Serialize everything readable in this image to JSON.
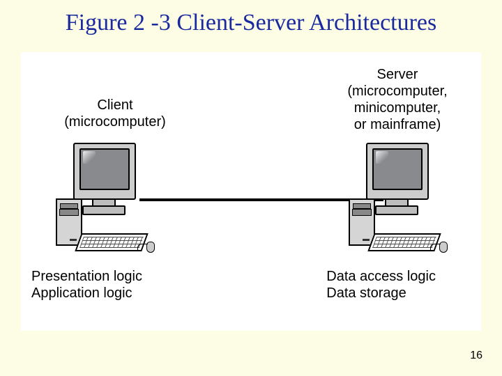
{
  "title": "Figure 2 -3 Client-Server Architectures",
  "client": {
    "top_label": "Client\n(microcomputer)",
    "bottom_label": "Presentation logic\nApplication logic"
  },
  "server": {
    "top_label": "Server\n(microcomputer,\nminicomputer,\nor mainframe)",
    "bottom_label": "Data access logic\nData storage"
  },
  "page_number": "16"
}
